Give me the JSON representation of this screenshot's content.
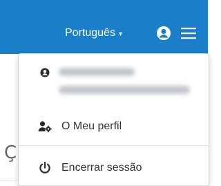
{
  "navbar": {
    "language_label": "Português",
    "language_caret": "▾",
    "user_icon": "user-circle-icon",
    "menu_icon": "hamburger-icon",
    "background": "#1a7fc8"
  },
  "page": {
    "partial_letter": "Ç"
  },
  "dropdown": {
    "user_icon": "user-icon",
    "user_name": "",
    "user_email": "",
    "items": [
      {
        "icon": "user-cog-icon",
        "label": "O Meu perfil"
      },
      {
        "icon": "power-icon",
        "label": "Encerrar sessão"
      }
    ]
  }
}
